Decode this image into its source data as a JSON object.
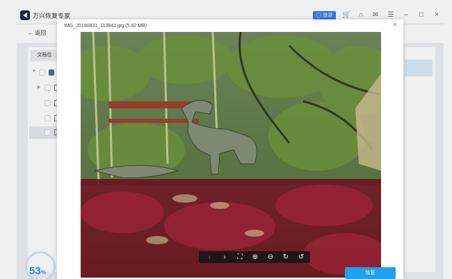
{
  "app": {
    "title": "万兴恢复专家",
    "login_label": "登录"
  },
  "nav": {
    "back_label": "返回",
    "tab_label": "文档位"
  },
  "progress": {
    "value": "53",
    "unit": "%"
  },
  "preview": {
    "filename": "IMG_20190831_113841.jpg (5.82 MB)",
    "restore_label": "恢复"
  },
  "colors": {
    "accent": "#1fa0ef",
    "login": "#3d7bf2",
    "progress": "#2b8ee8"
  }
}
